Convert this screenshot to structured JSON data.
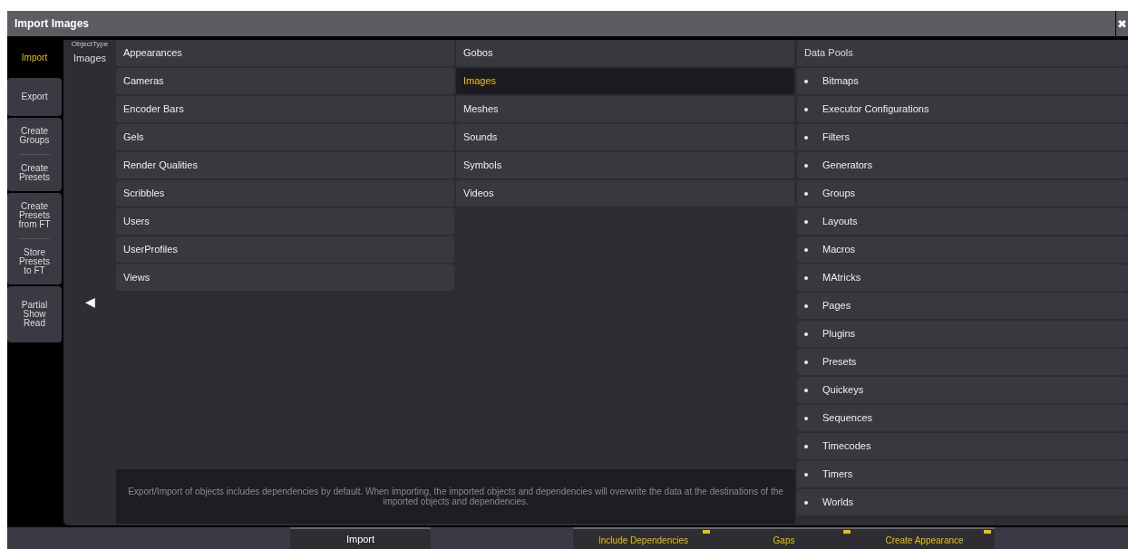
{
  "window": {
    "title": "Import Images",
    "close": "✖"
  },
  "sidebar": {
    "groups": [
      {
        "kind": "tab",
        "items": [
          {
            "label": "Import",
            "selected": true
          }
        ]
      },
      {
        "kind": "card",
        "items": [
          {
            "label": "Export",
            "selected": false
          }
        ]
      },
      {
        "kind": "card",
        "items": [
          {
            "label": "Create Groups",
            "selected": false
          },
          {
            "label": "Create Presets",
            "selected": false
          }
        ]
      },
      {
        "kind": "card",
        "items": [
          {
            "label": "Create Presets from FT",
            "selected": false
          },
          {
            "label": "Store Presets to FT",
            "selected": false
          }
        ]
      },
      {
        "kind": "card",
        "items": [
          {
            "label": "Partial Show Read",
            "selected": false
          }
        ]
      }
    ]
  },
  "object_type": {
    "caption": "ObjectType",
    "value": "Images",
    "back": "◀"
  },
  "columns": [
    {
      "items": [
        {
          "kind": "item",
          "label": "Appearances",
          "selected": false
        },
        {
          "kind": "item",
          "label": "Cameras",
          "selected": false
        },
        {
          "kind": "item",
          "label": "Encoder Bars",
          "selected": false
        },
        {
          "kind": "item",
          "label": "Gels",
          "selected": false
        },
        {
          "kind": "item",
          "label": "Render Qualities",
          "selected": false
        },
        {
          "kind": "item",
          "label": "Scribbles",
          "selected": false
        },
        {
          "kind": "item",
          "label": "Users",
          "selected": false
        },
        {
          "kind": "item",
          "label": "UserProfiles",
          "selected": false
        },
        {
          "kind": "item",
          "label": "Views",
          "selected": false
        }
      ]
    },
    {
      "items": [
        {
          "kind": "item",
          "label": "Gobos",
          "selected": false
        },
        {
          "kind": "item",
          "label": "Images",
          "selected": true
        },
        {
          "kind": "item",
          "label": "Meshes",
          "selected": false
        },
        {
          "kind": "item",
          "label": "Sounds",
          "selected": false
        },
        {
          "kind": "item",
          "label": "Symbols",
          "selected": false
        },
        {
          "kind": "item",
          "label": "Videos",
          "selected": false
        }
      ]
    },
    {
      "items": [
        {
          "kind": "header",
          "label": "Data Pools"
        },
        {
          "kind": "bullet",
          "label": "Bitmaps",
          "selected": false
        },
        {
          "kind": "bullet",
          "label": "Executor Configurations",
          "selected": false
        },
        {
          "kind": "bullet",
          "label": "Filters",
          "selected": false
        },
        {
          "kind": "bullet",
          "label": "Generators",
          "selected": false
        },
        {
          "kind": "bullet",
          "label": "Groups",
          "selected": false
        },
        {
          "kind": "bullet",
          "label": "Layouts",
          "selected": false
        },
        {
          "kind": "bullet",
          "label": "Macros",
          "selected": false
        },
        {
          "kind": "bullet",
          "label": "MAtricks",
          "selected": false
        },
        {
          "kind": "bullet",
          "label": "Pages",
          "selected": false
        },
        {
          "kind": "bullet",
          "label": "Plugins",
          "selected": false
        },
        {
          "kind": "bullet",
          "label": "Presets",
          "selected": false
        },
        {
          "kind": "bullet",
          "label": "Quickeys",
          "selected": false
        },
        {
          "kind": "bullet",
          "label": "Sequences",
          "selected": false
        },
        {
          "kind": "bullet",
          "label": "Timecodes",
          "selected": false
        },
        {
          "kind": "bullet",
          "label": "Timers",
          "selected": false
        },
        {
          "kind": "bullet",
          "label": "Worlds",
          "selected": false
        }
      ]
    }
  ],
  "info": "Export/Import of objects includes dependencies by default. When importing, the imported objects and dependencies will overwrite the data at the destinations of the imported objects and dependencies.",
  "bottom_bar": [
    {
      "kind": "spacer"
    },
    {
      "kind": "button",
      "label": "Import"
    },
    {
      "kind": "spacer"
    },
    {
      "kind": "toggle",
      "label": "Include Dependencies",
      "on": true
    },
    {
      "kind": "toggle",
      "label": "Gaps",
      "on": true
    },
    {
      "kind": "toggle",
      "label": "Create Appearance",
      "on": true
    }
  ]
}
